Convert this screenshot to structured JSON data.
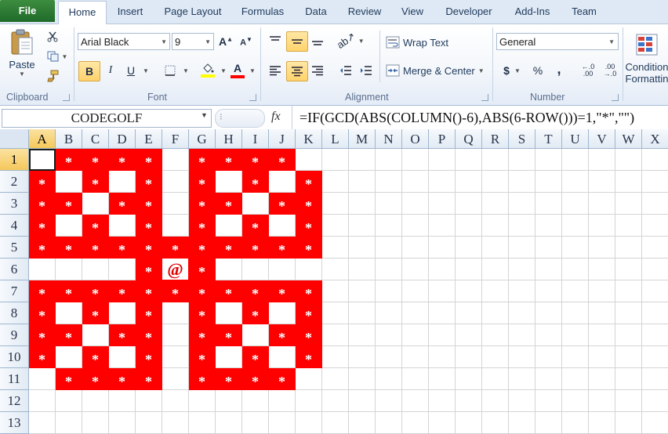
{
  "tabs": [
    {
      "label": "File"
    },
    {
      "label": "Home"
    },
    {
      "label": "Insert"
    },
    {
      "label": "Page Layout"
    },
    {
      "label": "Formulas"
    },
    {
      "label": "Data"
    },
    {
      "label": "Review"
    },
    {
      "label": "View"
    },
    {
      "label": "Developer"
    },
    {
      "label": "Add-Ins"
    },
    {
      "label": "Team"
    }
  ],
  "clipboard": {
    "paste_label": "Paste",
    "group_label": "Clipboard"
  },
  "font": {
    "name": "Arial Black",
    "size": "9",
    "group_label": "Font",
    "bold": "B",
    "italic": "I",
    "underline": "U",
    "fill_color": "#ffff00",
    "font_color": "#ff0000"
  },
  "alignment": {
    "wrap_text": "Wrap Text",
    "merge_center": "Merge & Center",
    "group_label": "Alignment"
  },
  "number": {
    "format": "General",
    "group_label": "Number",
    "currency": "$",
    "percent": "%",
    "comma": ",",
    "inc_decimal": "←.0 .00",
    "dec_decimal": ".00 →.0"
  },
  "styles": {
    "conditional_line1": "Condition",
    "conditional_line2": "Formattin"
  },
  "formula_bar": {
    "name_box": "CODEGOLF",
    "fx": "fx",
    "formula": "=IF(GCD(ABS(COLUMN()-6),ABS(6-ROW()))=1,\"*\",\"\")"
  },
  "sheet": {
    "columns": [
      "A",
      "B",
      "C",
      "D",
      "E",
      "F",
      "G",
      "H",
      "I",
      "J",
      "K",
      "L",
      "M",
      "N",
      "O",
      "P",
      "Q",
      "R",
      "S",
      "T",
      "U",
      "V",
      "W",
      "X"
    ],
    "rows": [
      "1",
      "2",
      "3",
      "4",
      "5",
      "6",
      "7",
      "8",
      "9",
      "10",
      "11",
      "12",
      "13"
    ],
    "fill_color": "#ff0000",
    "active_cell": "A1",
    "cells": [
      [
        "",
        "*",
        "*",
        "*",
        "*",
        "",
        "*",
        "*",
        "*",
        "*",
        ""
      ],
      [
        "*",
        "",
        "*",
        "",
        "*",
        "",
        "*",
        "",
        "*",
        "",
        "*"
      ],
      [
        "*",
        "*",
        "",
        "*",
        "*",
        "",
        "*",
        "*",
        "",
        "*",
        "*"
      ],
      [
        "*",
        "",
        "*",
        "",
        "*",
        "",
        "*",
        "",
        "*",
        "",
        "*"
      ],
      [
        "*",
        "*",
        "*",
        "*",
        "*",
        "*",
        "*",
        "*",
        "*",
        "*",
        "*"
      ],
      [
        "",
        "",
        "",
        "",
        "*",
        "@",
        "*",
        "",
        "",
        "",
        ""
      ],
      [
        "*",
        "*",
        "*",
        "*",
        "*",
        "*",
        "*",
        "*",
        "*",
        "*",
        "*"
      ],
      [
        "*",
        "",
        "*",
        "",
        "*",
        "",
        "*",
        "",
        "*",
        "",
        "*"
      ],
      [
        "*",
        "*",
        "",
        "*",
        "*",
        "",
        "*",
        "*",
        "",
        "*",
        "*"
      ],
      [
        "*",
        "",
        "*",
        "",
        "*",
        "",
        "*",
        "",
        "*",
        "",
        "*"
      ],
      [
        "",
        "*",
        "*",
        "*",
        "*",
        "",
        "*",
        "*",
        "*",
        "*",
        ""
      ],
      [
        "",
        "",
        "",
        "",
        "",
        "",
        "",
        "",
        "",
        "",
        ""
      ],
      [
        "",
        "",
        "",
        "",
        "",
        "",
        "",
        "",
        "",
        "",
        ""
      ]
    ]
  }
}
